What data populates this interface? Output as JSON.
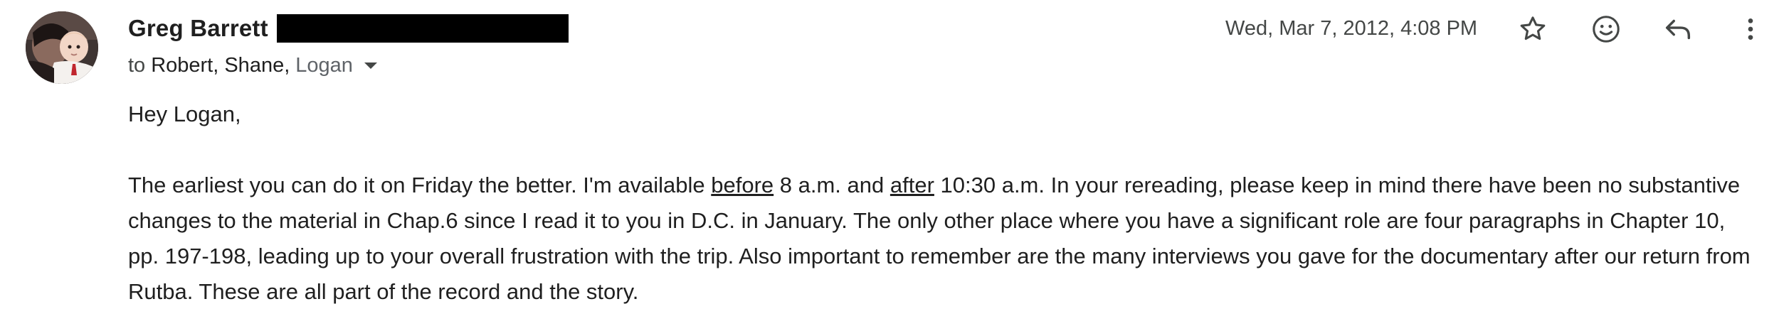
{
  "header": {
    "sender_name": "Greg Barrett",
    "recipients_prefix": "to",
    "recipients_known": "Robert, Shane,",
    "recipients_last": "Logan",
    "timestamp": "Wed, Mar 7, 2012, 4:08 PM"
  },
  "actions": {
    "star_icon": "star-icon",
    "emoji_icon": "emoji-reaction-icon",
    "reply_icon": "reply-icon",
    "more_icon": "more-vert-icon"
  },
  "message": {
    "greeting": "Hey Logan,",
    "p1_a": "The earliest you can do it on Friday the better. I'm available ",
    "p1_b": "before",
    "p1_c": " 8 a.m. and ",
    "p1_d": "after",
    "p1_e": " 10:30 a.m. In your rereading, please keep in mind there have been no substantive changes to the material in Chap.6 since I read it to you in D.C. in January. The only other place where you have a significant role are four paragraphs in Chapter 10, pp. 197-198, leading up to your overall frustration with the trip. Also important to remember are the many interviews you gave for the documentary after our return from Rutba. These are all part of the record and the story."
  },
  "colors": {
    "text": "#1f1f1f",
    "secondary": "#444746",
    "redaction": "#000000"
  }
}
